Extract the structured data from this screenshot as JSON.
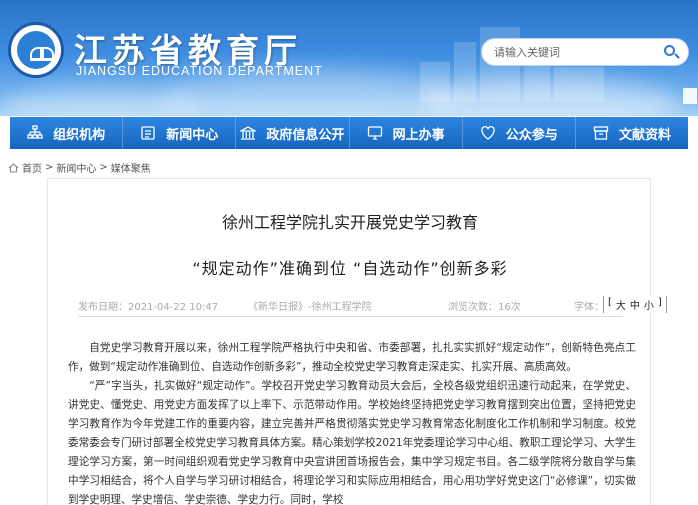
{
  "header": {
    "title": "江苏省教育厅",
    "subtitle": "JIANGSU EDUCATION DEPARTMENT",
    "search_placeholder": "请输入关键词"
  },
  "nav": {
    "items": [
      {
        "label": "组织机构",
        "icon": "org-chart-icon"
      },
      {
        "label": "新闻中心",
        "icon": "newspaper-icon"
      },
      {
        "label": "政府信息公开",
        "icon": "government-icon"
      },
      {
        "label": "网上办事",
        "icon": "monitor-icon"
      },
      {
        "label": "公众参与",
        "icon": "heart-icon"
      },
      {
        "label": "文献资料",
        "icon": "archive-icon"
      }
    ]
  },
  "breadcrumb": {
    "home": "首页",
    "sep": ">",
    "level1": "新闻中心",
    "level2": "媒体聚焦"
  },
  "article": {
    "title_line1": "徐州工程学院扎实开展党史学习教育",
    "title_line2": "“规定动作”准确到位  “自选动作”创新多彩",
    "meta": {
      "date": "发布日期：2021-04-22 10:47",
      "source": "《新华日报》-徐州工程学院",
      "views": "浏览次数：16次",
      "font_size_label": "字体：",
      "font_large": "大",
      "font_medium": "中",
      "font_small": "小",
      "bracket_open": "[",
      "bracket_close": "]"
    },
    "paragraphs": [
      "自党史学习教育开展以来，徐州工程学院严格执行中央和省、市委部署，扎扎实实抓好“规定动作”，创新特色亮点工作，做到“规定动作准确到位、自选动作创新多彩”，推动全校党史学习教育走深走实、扎实开展、高质高效。",
      "“严”字当头，扎实做好“规定动作”。学校召开党史学习教育动员大会后，全校各级党组织迅速行动起来，在学党史、讲党史、懂党史、用党史方面发挥了以上率下、示范带动作用。学校始终坚持把党史学习教育摆到突出位置，坚持把党史学习教育作为今年党建工作的重要内容，建立完善并严格贯彻落实党史学习教育常态化制度化工作机制和学习制度。校党委常委会专门研讨部署全校党史学习教育具体方案。精心策划学校2021年党委理论学习中心组、教职工理论学习、大学生理论学习方案，第一时间组织观看党史学习教育中央宣讲团首场报告会，集中学习规定书目。各二级学院将分散自学与集中学习相结合，将个人自学与学习研讨相结合，将理论学习和实际应用相结合，用心用功学好党史这门“必修课”，切实做到学史明理、学史增信、学史崇德、学史力行。同时，学校"
    ]
  }
}
